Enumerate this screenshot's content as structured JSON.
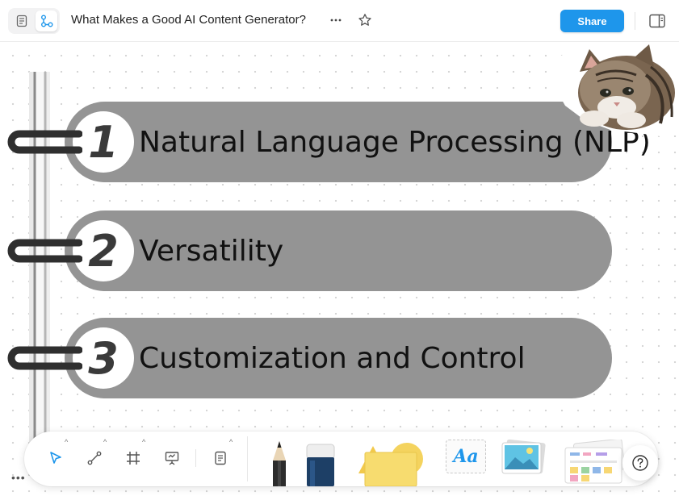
{
  "header": {
    "title": "What Makes a Good AI Content Generator?",
    "share_label": "Share",
    "icons": {
      "doc_mode": "page-mode-icon",
      "edgeless_mode": "edgeless-mode-icon",
      "more": "more-horizontal-icon",
      "favorite": "star-icon",
      "sidebar": "sidebar-toggle-icon"
    }
  },
  "canvas": {
    "items": [
      {
        "number": "1",
        "text": "Natural Language Processing (NLP)"
      },
      {
        "number": "2",
        "text": "Versatility"
      },
      {
        "number": "3",
        "text": "Customization and Control"
      }
    ],
    "pill_color": "#949494",
    "sticker": "cat-sticker"
  },
  "toolbar": {
    "tools": [
      "select-tool-icon",
      "connector-tool-icon",
      "frame-tool-icon",
      "presentation-tool-icon",
      "note-tool-icon"
    ],
    "tray": [
      "pencil",
      "eraser",
      "shapes",
      "text",
      "image",
      "templates"
    ],
    "text_tool_label": "Aa",
    "help": "?",
    "more": "•••"
  },
  "colors": {
    "accent": "#1e96eb",
    "pill": "#949494",
    "ring": "#2f2f2f"
  }
}
